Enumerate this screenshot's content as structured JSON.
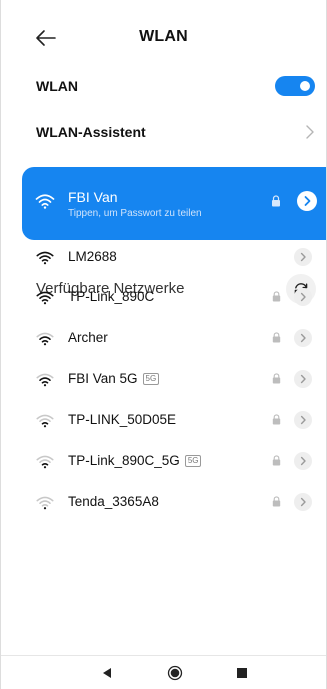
{
  "header": {
    "title": "WLAN",
    "back_icon": "arrow-left-icon"
  },
  "wlan": {
    "label": "WLAN",
    "enabled": true,
    "accent_color": "#1685f0"
  },
  "assistant": {
    "label": "WLAN-Assistent"
  },
  "connected": {
    "name": "FBI Van",
    "subtitle": "Tippen, um Passwort zu teilen",
    "locked": true,
    "background": "#1685f0"
  },
  "available": {
    "title": "Verfügbare Netzwerke",
    "refresh_icon": "refresh-icon",
    "networks": [
      {
        "name": "LM2688",
        "badge": "",
        "locked": false,
        "signal": 4
      },
      {
        "name": "TP-Link_890C",
        "badge": "",
        "locked": true,
        "signal": 4
      },
      {
        "name": "Archer",
        "badge": "",
        "locked": true,
        "signal": 3
      },
      {
        "name": "FBI Van 5G",
        "badge": "5G",
        "locked": true,
        "signal": 3
      },
      {
        "name": "TP-LINK_50D05E",
        "badge": "",
        "locked": true,
        "signal": 2
      },
      {
        "name": "TP-Link_890C_5G",
        "badge": "5G",
        "locked": true,
        "signal": 2
      },
      {
        "name": "Tenda_3365A8",
        "badge": "",
        "locked": true,
        "signal": 1
      }
    ]
  },
  "navbar": {
    "back_icon": "nav-back-icon",
    "home_icon": "nav-home-icon",
    "recents_icon": "nav-recents-icon"
  }
}
